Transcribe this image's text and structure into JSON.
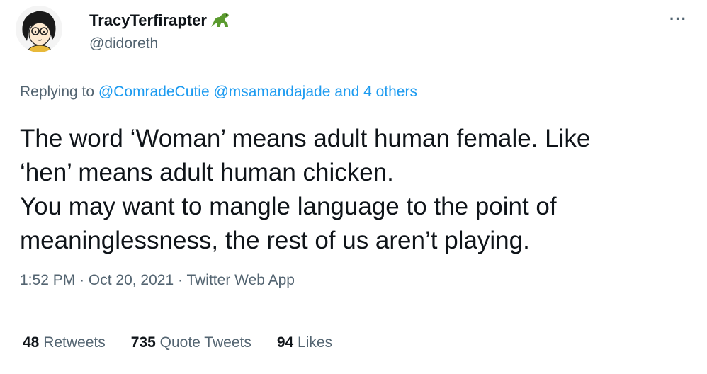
{
  "author": {
    "display_name": "TracyTerfirapter",
    "handle": "@didoreth",
    "avatar": "cartoon-avatar-icon",
    "badge": "dinosaur-emoji-icon"
  },
  "menu": {
    "more": "···"
  },
  "reply": {
    "prefix": "Replying to",
    "user1": "@ComradeCutie",
    "user2": "@msamandajade",
    "others": "and 4 others"
  },
  "tweet": {
    "lines": [
      "The word ‘Woman’ means adult human female.  Like",
      "‘hen’ means adult human chicken.",
      "You may want to mangle language to the point of",
      "meaninglessness, the rest of us aren’t playing."
    ]
  },
  "meta": {
    "time": "1:52 PM",
    "sep": "·",
    "date": "Oct 20, 2021",
    "source": "Twitter Web App"
  },
  "stats": {
    "retweets_count": "48",
    "retweets_label": "Retweets",
    "quotes_count": "735",
    "quotes_label": "Quote Tweets",
    "likes_count": "94",
    "likes_label": "Likes"
  },
  "colors": {
    "link": "#1d9bf0",
    "secondary": "#536471",
    "text": "#0f1419"
  }
}
